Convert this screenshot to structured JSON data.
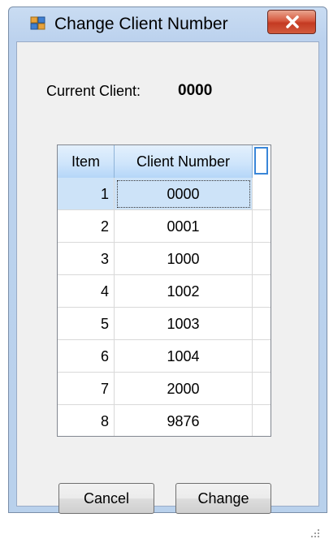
{
  "window": {
    "title": "Change Client Number",
    "colors": {
      "accent": "#3a86d8",
      "close_red": "#c43a22",
      "frame": "#bcd2ee"
    }
  },
  "current_client": {
    "label": "Current Client:",
    "value": "0000"
  },
  "grid": {
    "columns": [
      "Item",
      "Client Number"
    ],
    "selected_row": 0,
    "rows": [
      {
        "item": "1",
        "client": "0000"
      },
      {
        "item": "2",
        "client": "0001"
      },
      {
        "item": "3",
        "client": "1000"
      },
      {
        "item": "4",
        "client": "1002"
      },
      {
        "item": "5",
        "client": "1003"
      },
      {
        "item": "6",
        "client": "1004"
      },
      {
        "item": "7",
        "client": "2000"
      },
      {
        "item": "8",
        "client": "9876"
      }
    ]
  },
  "buttons": {
    "cancel_label": "Cancel",
    "change_label": "Change"
  },
  "icons": {
    "app": "window-app-icon",
    "close": "close-icon",
    "grip": "resize-grip-icon"
  }
}
